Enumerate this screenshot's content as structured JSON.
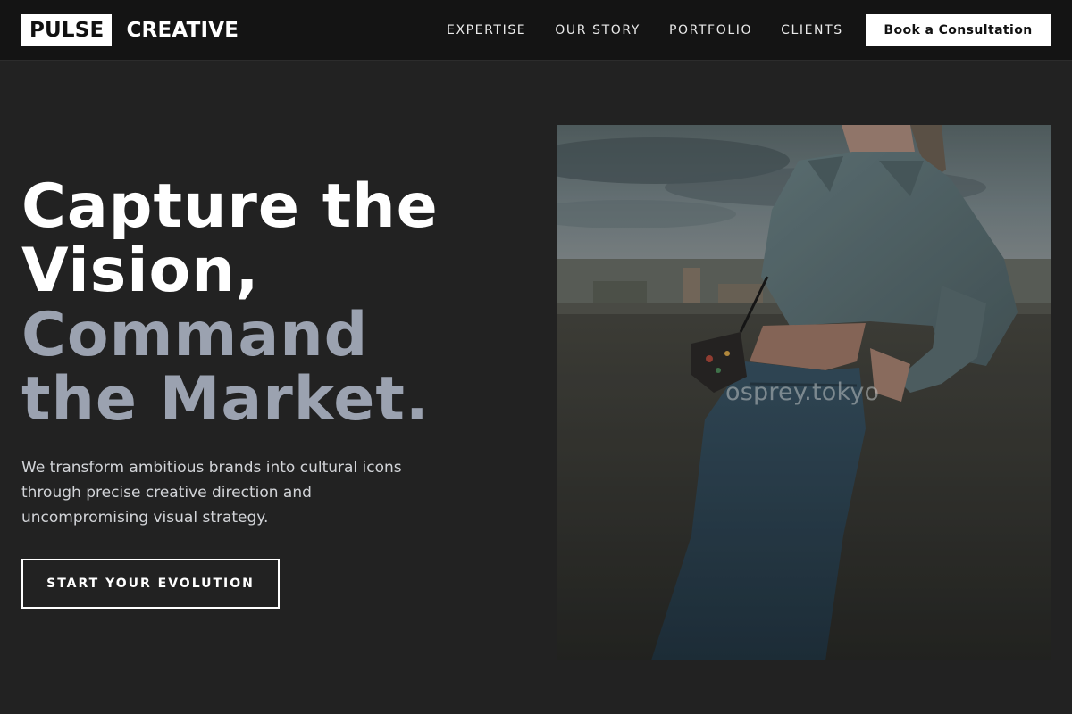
{
  "brand": {
    "name_box": "PULSE",
    "name_rest": "CREATIVE"
  },
  "nav": {
    "items": [
      {
        "label": "EXPERTISE"
      },
      {
        "label": "OUR STORY"
      },
      {
        "label": "PORTFOLIO"
      },
      {
        "label": "CLIENTS"
      }
    ],
    "cta_label": "Book a Consultation"
  },
  "hero": {
    "headline_lines": [
      {
        "text": "Capture the",
        "tone": "white"
      },
      {
        "text": "Vision,",
        "tone": "white"
      },
      {
        "text": "Command",
        "tone": "muted"
      },
      {
        "text": "the Market.",
        "tone": "muted"
      }
    ],
    "subtext": "We transform ambitious brands into cultural icons through precise creative direction and uncompromising visual strategy.",
    "cta_label": "START YOUR EVOLUTION",
    "image": {
      "subject": "person in cropped denim jacket and jeans leaning on a concrete wall at dusk",
      "watermark": "osprey.tokyo"
    }
  },
  "colors": {
    "background": "#222222",
    "header": "#141414",
    "accent_white": "#ffffff",
    "muted_headline": "#9ba2b0"
  }
}
